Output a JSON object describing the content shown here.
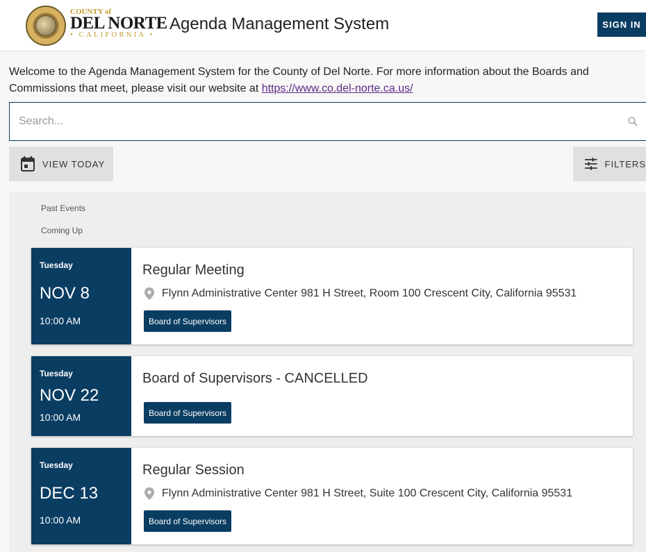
{
  "header": {
    "logo": {
      "line1": "COUNTY of",
      "line2": "DEL NORTE",
      "line3": "• CALIFORNIA •"
    },
    "title": "Agenda Management System",
    "signin_label": "SIGN IN"
  },
  "intro": {
    "welcome_text": "Welcome to the Agenda Management System for the County of Del Norte.  For more information about the Boards and Commissions that meet, please visit our website at ",
    "website_link": "https://www.co.del-norte.ca.us/"
  },
  "search": {
    "placeholder": "Search..."
  },
  "toolbar": {
    "view_today_label": "VIEW TODAY",
    "filters_label": "FILTERS"
  },
  "tabs": {
    "past": "Past Events",
    "upcoming": "Coming Up"
  },
  "events": [
    {
      "day": "Tuesday",
      "date": "NOV 8",
      "time": "10:00 AM",
      "title": "Regular Meeting",
      "location": "Flynn Administrative Center 981 H Street, Room 100 Crescent City, California 95531",
      "tag": "Board of Supervisors"
    },
    {
      "day": "Tuesday",
      "date": "NOV 22",
      "time": "10:00 AM",
      "title": "Board of Supervisors - CANCELLED",
      "location": "",
      "tag": "Board of Supervisors"
    },
    {
      "day": "Tuesday",
      "date": "DEC 13",
      "time": "10:00 AM",
      "title": "Regular Session",
      "location": "Flynn Administrative Center 981 H Street, Suite 100 Crescent City, California 95531",
      "tag": "Board of Supervisors"
    }
  ],
  "colors": {
    "primary": "#0a3d62",
    "link": "#5b2a86",
    "gray_button": "#e0e0e0",
    "panel": "#eeeeee"
  }
}
